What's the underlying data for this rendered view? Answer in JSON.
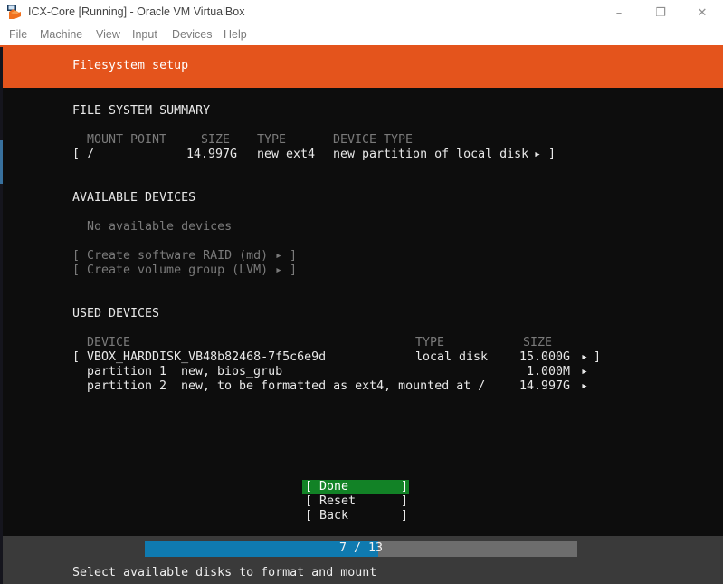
{
  "window": {
    "title": "ICX-Core [Running] - Oracle VM VirtualBox",
    "controls": {
      "minimize": "–",
      "maximize": "❐",
      "close": "✕"
    }
  },
  "menubar": {
    "items": [
      {
        "label": "File"
      },
      {
        "label": "Machine"
      },
      {
        "label": "View"
      },
      {
        "label": "Input"
      },
      {
        "label": "Devices"
      },
      {
        "label": "Help"
      }
    ]
  },
  "glyphs": {
    "open_bracket": "[",
    "close_bracket": "]",
    "arrow": "▸"
  },
  "installer": {
    "header": {
      "title": "Filesystem setup"
    },
    "file_system_summary": {
      "heading": "FILE SYSTEM SUMMARY",
      "columns": {
        "mount_point": "MOUNT POINT",
        "size": "SIZE",
        "type": "TYPE",
        "device_type": "DEVICE TYPE"
      },
      "row": {
        "mount_point": "/",
        "size": "14.997G",
        "type": "new ext4",
        "device_type": "new partition of local disk"
      }
    },
    "available_devices": {
      "heading": "AVAILABLE DEVICES",
      "empty_text": "No available devices",
      "actions": [
        {
          "label": "Create software RAID (md)"
        },
        {
          "label": "Create volume group (LVM)"
        }
      ]
    },
    "used_devices": {
      "heading": "USED DEVICES",
      "columns": {
        "device": "DEVICE",
        "type": "TYPE",
        "size": "SIZE"
      },
      "disk": {
        "name": "VBOX_HARDDISK_VB48b82468-7f5c6e9d",
        "type": "local disk",
        "size": "15.000G"
      },
      "partitions": [
        {
          "name": "partition 1",
          "desc": "new, bios_grub",
          "size": "1.000M"
        },
        {
          "name": "partition 2",
          "desc": "new, to be formatted as ext4, mounted at /",
          "size": "14.997G"
        }
      ]
    },
    "buttons": [
      {
        "label": "Done",
        "selected": true
      },
      {
        "label": "Reset",
        "selected": false
      },
      {
        "label": "Back",
        "selected": false
      }
    ],
    "progress": {
      "label": "7 / 13",
      "current": 7,
      "total": 13
    },
    "footer_hint": "Select available disks to format and mount",
    "colors": {
      "accent_orange": "#e4541c",
      "selected_green": "#128226",
      "progress_blue": "#0f7ab0",
      "progress_track": "#6d6d6d",
      "terminal_bg": "#0d0d0d",
      "footer_bg": "#3a3a3a",
      "muted_text": "#7a7a7a",
      "text": "#e8e8e8"
    }
  }
}
